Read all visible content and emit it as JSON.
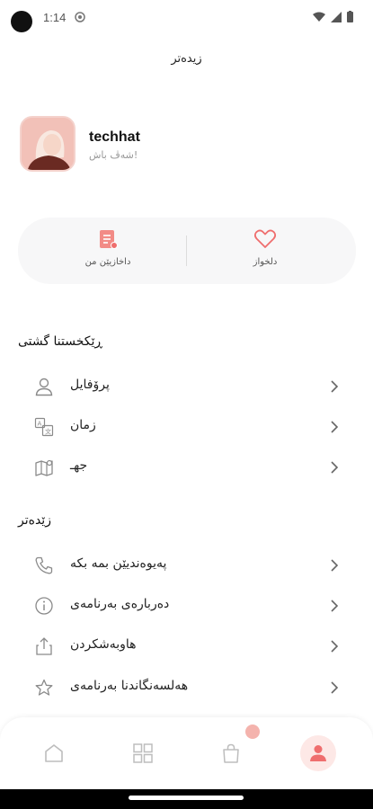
{
  "status_bar": {
    "time": "1:14"
  },
  "header": {
    "title": "زیدەتر"
  },
  "profile": {
    "name": "techhat",
    "subtitle": "شەڤ باش!"
  },
  "quick_actions": {
    "orders_label": "داخازیێن من",
    "favorites_label": "دلخواز"
  },
  "sections": {
    "general": {
      "title": "ڕێکخستنا گشتی",
      "items": [
        {
          "label": "پرۆفایل",
          "icon": "user-icon"
        },
        {
          "label": "زمان",
          "icon": "translate-icon"
        },
        {
          "label": "جهـ",
          "icon": "map-pin-icon"
        }
      ]
    },
    "more": {
      "title": "زێدەتر",
      "items": [
        {
          "label": "پەیوەندیێن بمە بکە",
          "icon": "phone-icon"
        },
        {
          "label": "دەربارەی بەرنامەی",
          "icon": "info-icon"
        },
        {
          "label": "هاوبەشکردن",
          "icon": "share-icon"
        },
        {
          "label": "هەلسەنگاندنا بەرنامەی",
          "icon": "star-icon"
        }
      ]
    }
  },
  "bottom_nav": {
    "cart_badge": "",
    "items": [
      "home-icon",
      "grid-icon",
      "bag-icon",
      "profile-icon"
    ]
  },
  "colors": {
    "accent": "#ef6e6e",
    "accent_soft": "#fde8e6",
    "card_bg": "#f7f7f8",
    "icon_gray": "#8a8a8a"
  }
}
